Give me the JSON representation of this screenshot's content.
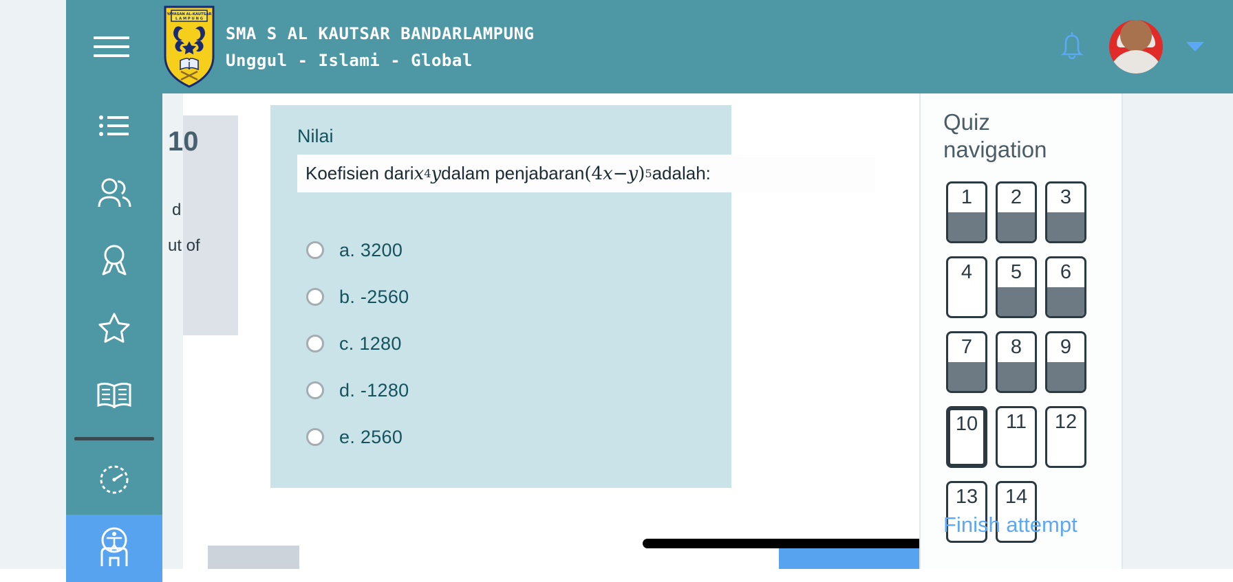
{
  "header": {
    "menu_icon": "hamburger-icon",
    "school_name": "SMA S AL KAUTSAR BANDARLAMPUNG",
    "tagline": "Unggul - Islami - Global",
    "logo_line1": "YAYASAN AL-KAUTSAR",
    "logo_line2": "L A M P U N G",
    "bell_icon": "notification-bell-icon",
    "avatar_icon": "user-avatar",
    "caret_icon": "chevron-down-icon",
    "bg_color": "#4d98a4"
  },
  "sidebar": {
    "items": [
      {
        "icon": "list-icon",
        "name": "sidebar-item-list",
        "active": false
      },
      {
        "icon": "users-icon",
        "name": "sidebar-item-participants",
        "active": false
      },
      {
        "icon": "badge-icon",
        "name": "sidebar-item-badges",
        "active": false
      },
      {
        "icon": "star-icon",
        "name": "sidebar-item-competencies",
        "active": false
      },
      {
        "icon": "book-icon",
        "name": "sidebar-item-grades",
        "active": false
      },
      {
        "icon": "speedometer-icon",
        "name": "sidebar-item-dashboard",
        "active": false
      },
      {
        "icon": "accessibility-icon",
        "name": "sidebar-item-accessibility",
        "active": true
      }
    ],
    "active_color": "#58a3f0",
    "bg_color": "#4d98a4"
  },
  "question_info": {
    "number": "10",
    "state_fragment": "d",
    "marks_fragment": "ut of"
  },
  "question": {
    "label": "Nilai",
    "text_prefix": "Koefisien dari ",
    "var1": "x",
    "var1_exp": "4",
    "var2": "y",
    "text_middle": " dalam penjabaran ",
    "expr_open": "(4",
    "expr_var_x": "x",
    "expr_minus": " − ",
    "expr_var_y": "y",
    "expr_close": ")",
    "expr_exp": "5",
    "text_suffix": " adalah:",
    "full_text": "Koefisien dari x^4 y dalam penjabaran (4x − y)^5 adalah:",
    "bg_color": "#cae3e9",
    "options": [
      {
        "key": "a",
        "label": "a. 3200",
        "selected": false
      },
      {
        "key": "b",
        "label": "b. -2560",
        "selected": false
      },
      {
        "key": "c",
        "label": "c. 1280",
        "selected": false
      },
      {
        "key": "d",
        "label": "d. -1280",
        "selected": false
      },
      {
        "key": "e",
        "label": "e. 2560",
        "selected": false
      }
    ]
  },
  "bottom_bar": {
    "left_button": "",
    "right_button": "",
    "scrollbar": "horizontal-scrollbar"
  },
  "quiz_navigation": {
    "title": "Quiz navigation",
    "finish_label": "Finish attempt",
    "finish_color": "#5da8f5",
    "fill_color": "#6e7a83",
    "buttons": [
      {
        "number": "1",
        "answered": true,
        "current": false
      },
      {
        "number": "2",
        "answered": true,
        "current": false
      },
      {
        "number": "3",
        "answered": true,
        "current": false
      },
      {
        "number": "4",
        "answered": false,
        "current": false
      },
      {
        "number": "5",
        "answered": true,
        "current": false
      },
      {
        "number": "6",
        "answered": true,
        "current": false
      },
      {
        "number": "7",
        "answered": true,
        "current": false
      },
      {
        "number": "8",
        "answered": true,
        "current": false
      },
      {
        "number": "9",
        "answered": true,
        "current": false
      },
      {
        "number": "10",
        "answered": false,
        "current": true
      },
      {
        "number": "11",
        "answered": false,
        "current": false
      },
      {
        "number": "12",
        "answered": false,
        "current": false
      },
      {
        "number": "13",
        "answered": false,
        "current": false
      },
      {
        "number": "14",
        "answered": false,
        "current": false
      }
    ]
  },
  "colors": {
    "page_bg": "#edf3f5",
    "teal": "#4d98a4",
    "panel_blue": "#cae3e9",
    "text_dark": "#14535e"
  }
}
